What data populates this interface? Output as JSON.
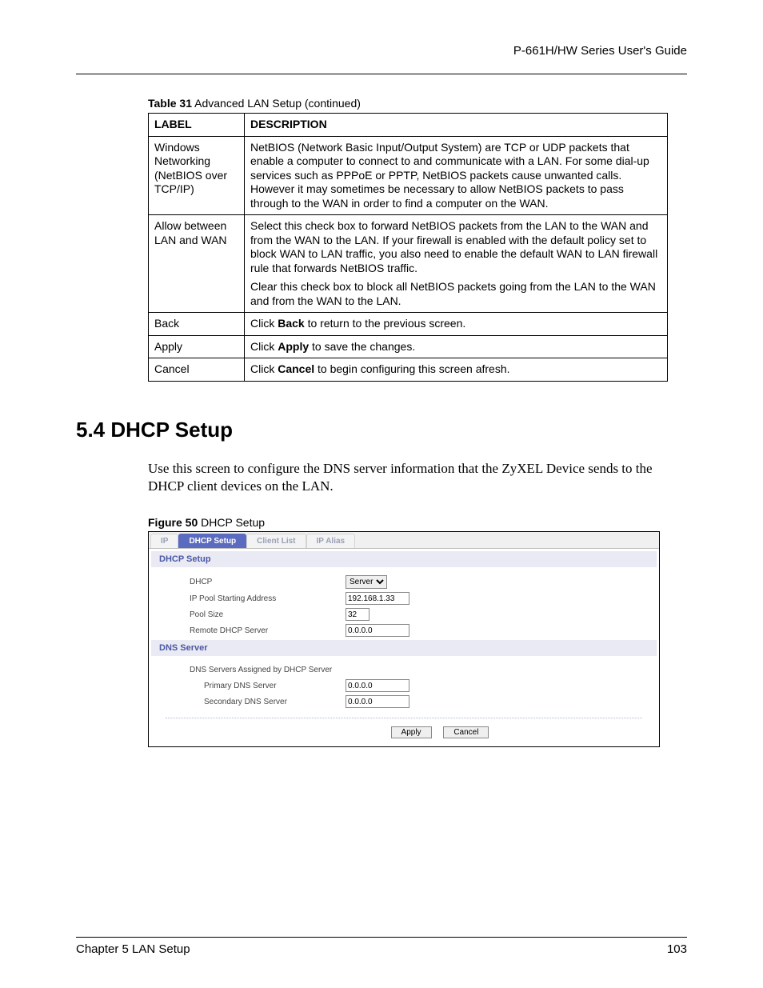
{
  "header": {
    "guide_title": "P-661H/HW Series User's Guide"
  },
  "table_caption": {
    "bold": "Table 31",
    "rest": "   Advanced LAN Setup (continued)"
  },
  "table": {
    "head": {
      "label": "LABEL",
      "desc": "DESCRIPTION"
    },
    "rows": [
      {
        "label": "Windows Networking (NetBIOS over TCP/IP)",
        "desc_parts": [
          "NetBIOS (Network Basic Input/Output System) are TCP or UDP packets that enable a computer to connect to and communicate with a LAN. For some dial-up services such as PPPoE or PPTP, NetBIOS packets cause unwanted calls. However it may sometimes be necessary to allow NetBIOS packets to pass through to the WAN in order to find a computer on the WAN."
        ]
      },
      {
        "label": "Allow between LAN and WAN",
        "desc_parts": [
          "Select this check box to forward NetBIOS packets from the LAN to the WAN and from the WAN to the LAN. If your firewall is enabled with the default policy set to block WAN to LAN traffic, you also need to enable the default WAN to LAN firewall rule that forwards NetBIOS traffic.",
          "Clear this check box to block all NetBIOS packets going from the LAN to the WAN and from the WAN to the LAN."
        ]
      },
      {
        "label": "Back",
        "desc_pre": "Click ",
        "desc_bold": "Back",
        "desc_post": " to return to the previous screen."
      },
      {
        "label": "Apply",
        "desc_pre": "Click ",
        "desc_bold": "Apply",
        "desc_post": " to save the changes."
      },
      {
        "label": "Cancel",
        "desc_pre": "Click ",
        "desc_bold": "Cancel",
        "desc_post": " to begin configuring this screen afresh."
      }
    ]
  },
  "section": {
    "heading": "5.4  DHCP Setup",
    "body": "Use this screen to configure the DNS server information that the ZyXEL Device sends to the DHCP client devices on the LAN."
  },
  "figure_caption": {
    "bold": "Figure 50",
    "rest": "   DHCP Setup"
  },
  "screenshot": {
    "tabs": [
      "IP",
      "DHCP Setup",
      "Client List",
      "IP Alias"
    ],
    "active_tab_index": 1,
    "dhcp_header": "DHCP Setup",
    "dns_header": "DNS Server",
    "rows": {
      "dhcp_label": "DHCP",
      "dhcp_value": "Server",
      "ip_pool_label": "IP Pool Starting Address",
      "ip_pool_value": "192.168.1.33",
      "pool_size_label": "Pool Size",
      "pool_size_value": "32",
      "remote_dhcp_label": "Remote DHCP Server",
      "remote_dhcp_value": "0.0.0.0",
      "dns_assigned_label": "DNS Servers Assigned by DHCP Server",
      "primary_dns_label": "Primary DNS Server",
      "primary_dns_value": "0.0.0.0",
      "secondary_dns_label": "Secondary DNS Server",
      "secondary_dns_value": "0.0.0.0"
    },
    "buttons": {
      "apply": "Apply",
      "cancel": "Cancel"
    }
  },
  "footer": {
    "chapter": "Chapter 5 LAN Setup",
    "page": "103"
  }
}
